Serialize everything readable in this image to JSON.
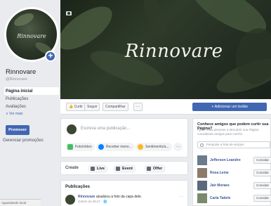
{
  "sidebar": {
    "page_name": "Rinnovare",
    "handle": "@Rinnovare",
    "nav": [
      {
        "label": "Página inicial",
        "active": true
      },
      {
        "label": "Publicações",
        "active": false
      },
      {
        "label": "Avaliações",
        "active": false
      }
    ],
    "see_more": "∨ Ver mais",
    "promote": "Promover",
    "manage_promotions": "Gerenciar promoções",
    "status": "Aguardando local"
  },
  "cover": {
    "brand": "Rinnovare"
  },
  "action_bar": {
    "like": "👍 Curtir",
    "follow": "Seguir",
    "share": "Compartilhar",
    "more": "···",
    "add_button": "+ Adicionar um botão"
  },
  "composer": {
    "placeholder": "Escreva uma publicação...",
    "options": [
      "Foto/vídeo",
      "Receber mens...",
      "Sentimento/a...",
      "···"
    ]
  },
  "create": {
    "label": "Create",
    "live": "Live",
    "event": "Event",
    "offer": "Offer"
  },
  "posts": {
    "title": "Publicações",
    "author": "Rinnovare",
    "action": "atualizou a foto da capa dele.",
    "time": "Ontem às 08:47 · 🌐",
    "menu": "···"
  },
  "invite": {
    "heading": "Conhece amigos que podem curtir sua Página?",
    "subtext": "Ajude mais pessoas a descobrir sua Página convidando amigos para curti-la.",
    "search_placeholder": "Pesquise a lista de amigos",
    "invite_label": "Convidar",
    "friends": [
      "Jefferson Leandro",
      "Rosa Leme",
      "Jair Moraes",
      "Carla Tatiele"
    ]
  }
}
